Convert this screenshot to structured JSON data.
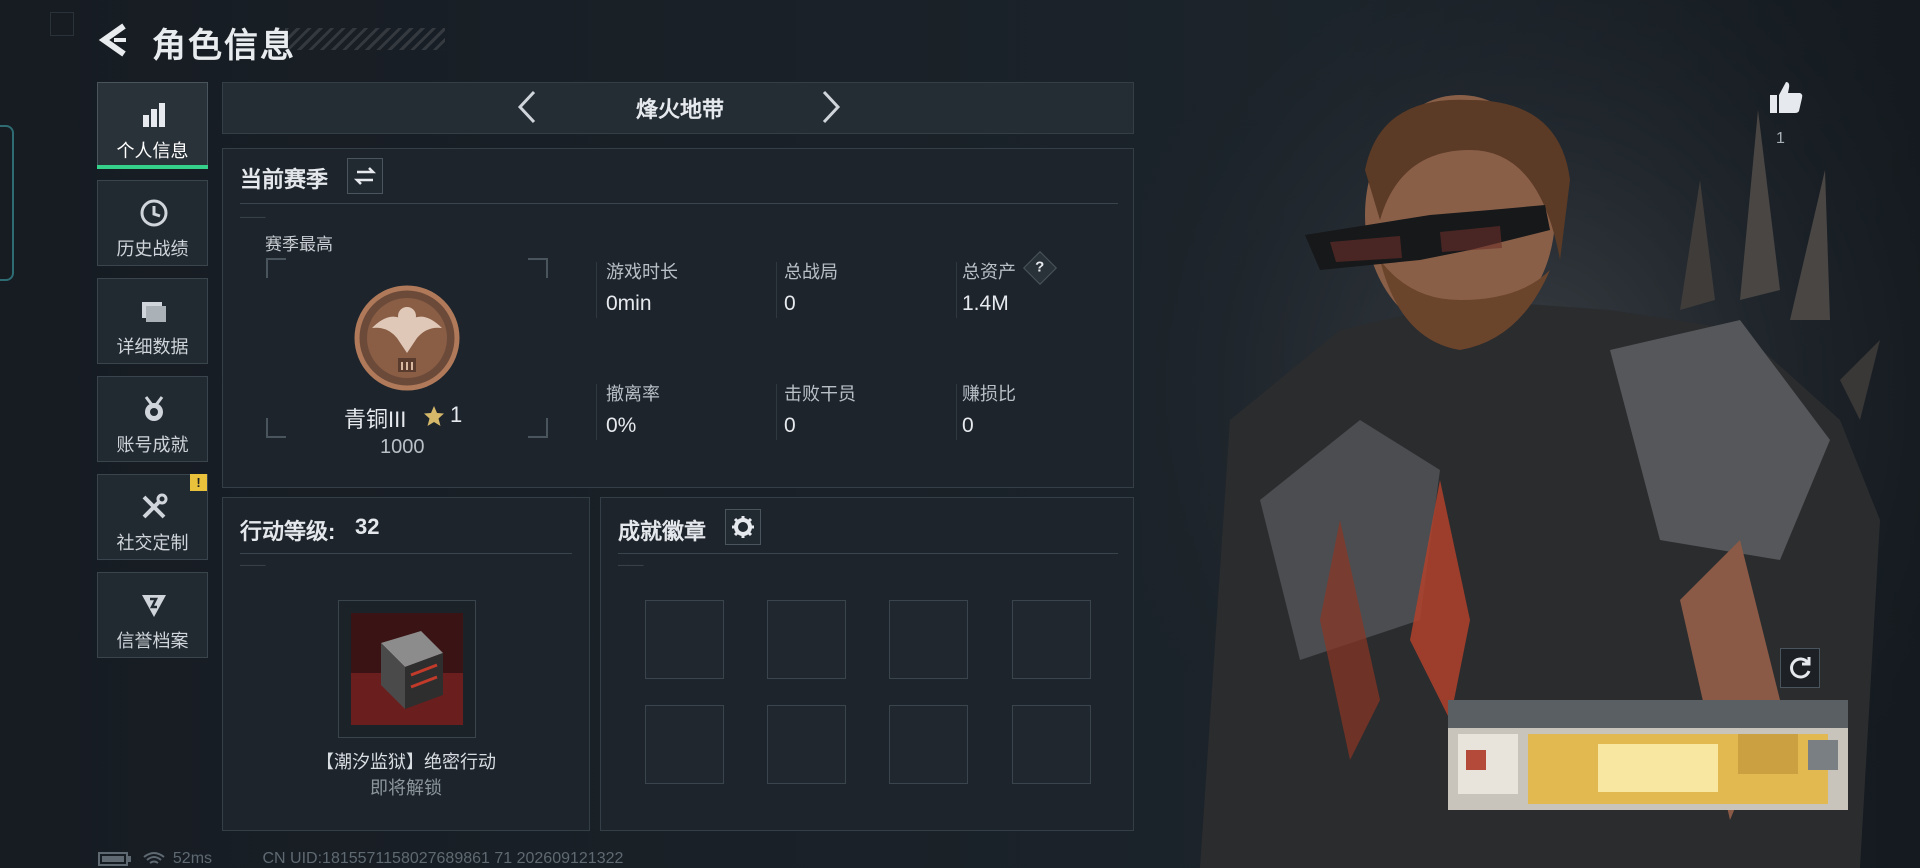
{
  "header": {
    "title": "角色信息"
  },
  "sidebar": {
    "items": [
      {
        "label": "个人信息",
        "icon": "bar-chart-icon",
        "active": true
      },
      {
        "label": "历史战绩",
        "icon": "clock-icon"
      },
      {
        "label": "详细数据",
        "icon": "folder-icon"
      },
      {
        "label": "账号成就",
        "icon": "medal-icon"
      },
      {
        "label": "社交定制",
        "icon": "tools-icon",
        "badge": "!"
      },
      {
        "label": "信誉档案",
        "icon": "shield-icon"
      }
    ]
  },
  "mode": {
    "label": "烽火地带"
  },
  "season": {
    "title": "当前赛季",
    "best_label": "赛季最高",
    "rank_name": "青铜III",
    "rank_stars": "1",
    "rank_score": "1000",
    "stats": [
      {
        "label": "游戏时长",
        "value": "0min"
      },
      {
        "label": "总战局",
        "value": "0"
      },
      {
        "label": "总资产",
        "value": "1.4M",
        "help": "?"
      },
      {
        "label": "撤离率",
        "value": "0%"
      },
      {
        "label": "击败干员",
        "value": "0"
      },
      {
        "label": "赚损比",
        "value": "0"
      }
    ]
  },
  "action_level": {
    "label": "行动等级:",
    "value": "32",
    "item_name": "【潮汐监狱】绝密行动",
    "item_status": "即将解锁"
  },
  "achievements": {
    "title": "成就徽章"
  },
  "like": {
    "count": "1"
  },
  "footer": {
    "ping": "52ms",
    "uid": "CN UID:1815571158027689861 71 202609121322"
  },
  "colors": {
    "accent": "#35d08a",
    "badge": "#e9c13a",
    "rank_bronze": "#b07a5a"
  }
}
